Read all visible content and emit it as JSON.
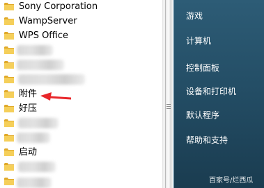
{
  "programs": {
    "items": [
      {
        "label": "Sony Corporation"
      },
      {
        "label": "WampServer"
      },
      {
        "label": "WPS Office"
      },
      {
        "label": ""
      },
      {
        "label": ""
      },
      {
        "label": ""
      },
      {
        "label": "附件"
      },
      {
        "label": "好压"
      },
      {
        "label": ""
      },
      {
        "label": ""
      },
      {
        "label": "启动"
      },
      {
        "label": ""
      }
    ]
  },
  "right_panel": {
    "items": [
      {
        "label": "游戏"
      },
      {
        "label": "计算机"
      },
      {
        "label": "控制面板"
      },
      {
        "label": "设备和打印机"
      },
      {
        "label": "默认程序"
      },
      {
        "label": "帮助和支持"
      }
    ],
    "watermark": "百家号/烂西瓜"
  },
  "annotation": {
    "color": "#e8262a"
  },
  "colors": {
    "folder_yellow": "#f2c94c",
    "panel_blue": "#244e66"
  }
}
